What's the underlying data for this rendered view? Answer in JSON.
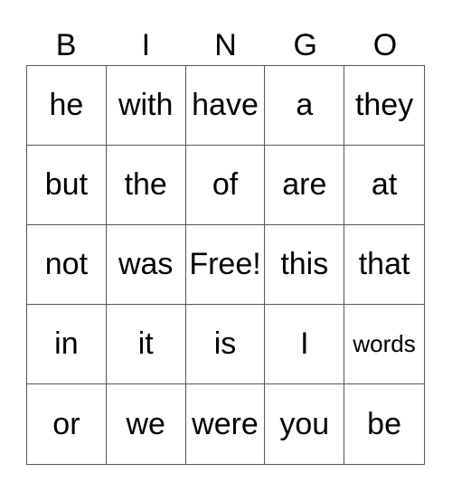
{
  "header": [
    "B",
    "I",
    "N",
    "G",
    "O"
  ],
  "cells": [
    "he",
    "with",
    "have",
    "a",
    "they",
    "but",
    "the",
    "of",
    "are",
    "at",
    "not",
    "was",
    "Free!",
    "this",
    "that",
    "in",
    "it",
    "is",
    "I",
    "words",
    "or",
    "we",
    "were",
    "you",
    "be"
  ]
}
